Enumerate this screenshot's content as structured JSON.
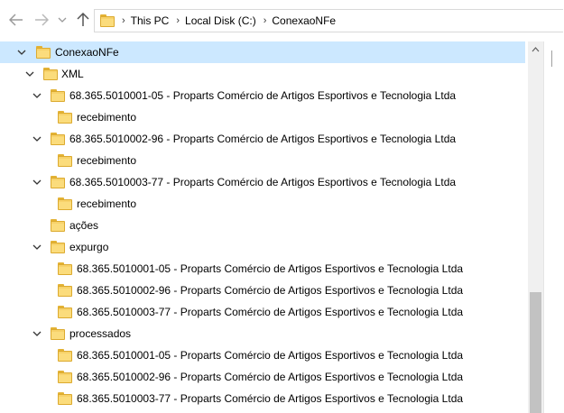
{
  "address_bar": {
    "breadcrumbs": [
      "This PC",
      "Local Disk (C:)",
      "ConexaoNFe"
    ]
  },
  "tree": {
    "root": "ConexaoNFe",
    "xml": "XML",
    "company1": "68.365.5010001-05 - Proparts Comércio de Artigos Esportivos e Tecnologia Ltda",
    "company2": "68.365.5010002-96 - Proparts Comércio de Artigos Esportivos e Tecnologia Ltda",
    "company3": "68.365.5010003-77 - Proparts Comércio de Artigos Esportivos e Tecnologia Ltda",
    "recebimento": "recebimento",
    "acoes": "ações",
    "expurgo": "expurgo",
    "processados": "processados"
  },
  "colors": {
    "selection": "#cce8ff",
    "folder": "#f7d26a"
  }
}
